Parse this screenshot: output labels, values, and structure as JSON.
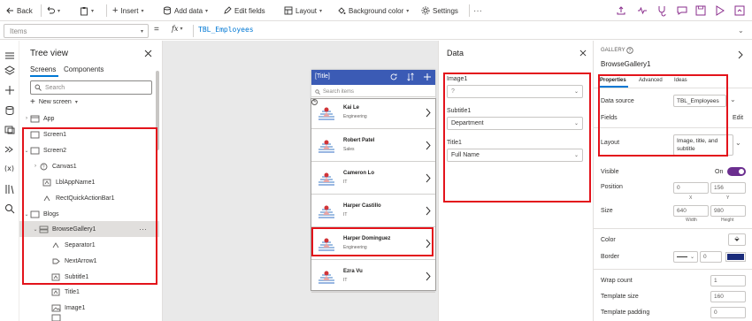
{
  "toolbar": {
    "back": "Back",
    "insert": "Insert",
    "add_data": "Add data",
    "edit_fields": "Edit fields",
    "layout": "Layout",
    "background_color": "Background color",
    "settings": "Settings"
  },
  "formula_bar": {
    "property": "Items",
    "fx": "fx",
    "formula": "TBL_Employees"
  },
  "tree_view": {
    "title": "Tree view",
    "tabs": [
      "Screens",
      "Components"
    ],
    "search_placeholder": "Search",
    "new_screen": "New screen",
    "items": [
      {
        "label": "App"
      },
      {
        "label": "Screen1"
      },
      {
        "label": "Screen2"
      },
      {
        "label": "Canvas1"
      },
      {
        "label": "LblAppName1"
      },
      {
        "label": "RectQuickActionBar1"
      },
      {
        "label": "Blogs"
      },
      {
        "label": "BrowseGallery1"
      },
      {
        "label": "Separator1"
      },
      {
        "label": "NextArrow1"
      },
      {
        "label": "Subtitle1"
      },
      {
        "label": "Title1"
      },
      {
        "label": "Image1"
      }
    ]
  },
  "app_preview": {
    "title": "[Title]",
    "search_placeholder": "Search items",
    "items": [
      {
        "name": "Kai Le",
        "dept": "Engineering"
      },
      {
        "name": "Robert Patel",
        "dept": "Sales"
      },
      {
        "name": "Cameron Lo",
        "dept": "IT"
      },
      {
        "name": "Harper Castillo",
        "dept": "IT"
      },
      {
        "name": "Harper Dominguez",
        "dept": "Engineering"
      },
      {
        "name": "Ezra Vu",
        "dept": "IT"
      }
    ]
  },
  "data_pane": {
    "title": "Data",
    "image_label": "Image1",
    "image_value": "?",
    "subtitle_label": "Subtitle1",
    "subtitle_value": "Department",
    "title_label": "Title1",
    "title_value": "Full Name"
  },
  "properties": {
    "kind": "GALLERY",
    "name": "BrowseGallery1",
    "tabs": [
      "Properties",
      "Advanced",
      "Ideas"
    ],
    "data_source_label": "Data source",
    "data_source_value": "TBL_Employees",
    "fields_label": "Fields",
    "edit_link": "Edit",
    "layout_label": "Layout",
    "layout_value": "Image, title, and subtitle",
    "visible_label": "Visible",
    "visible_value": "On",
    "position_label": "Position",
    "position_x": "0",
    "position_y": "156",
    "x_label": "X",
    "y_label": "Y",
    "size_label": "Size",
    "width_value": "640",
    "height_value": "980",
    "width_label": "Width",
    "height_label": "Height",
    "color_label": "Color",
    "border_label": "Border",
    "border_value": "0",
    "wrap_label": "Wrap count",
    "wrap_value": "1",
    "template_size_label": "Template size",
    "template_size_value": "160",
    "template_padding_label": "Template padding",
    "template_padding_value": "0"
  },
  "colors": {
    "accent": "#0078d4",
    "app_header": "#3b5bb5",
    "highlight": "#e3131b",
    "toggle": "#6b2e8f",
    "border_swatch": "#1a2b7a"
  }
}
